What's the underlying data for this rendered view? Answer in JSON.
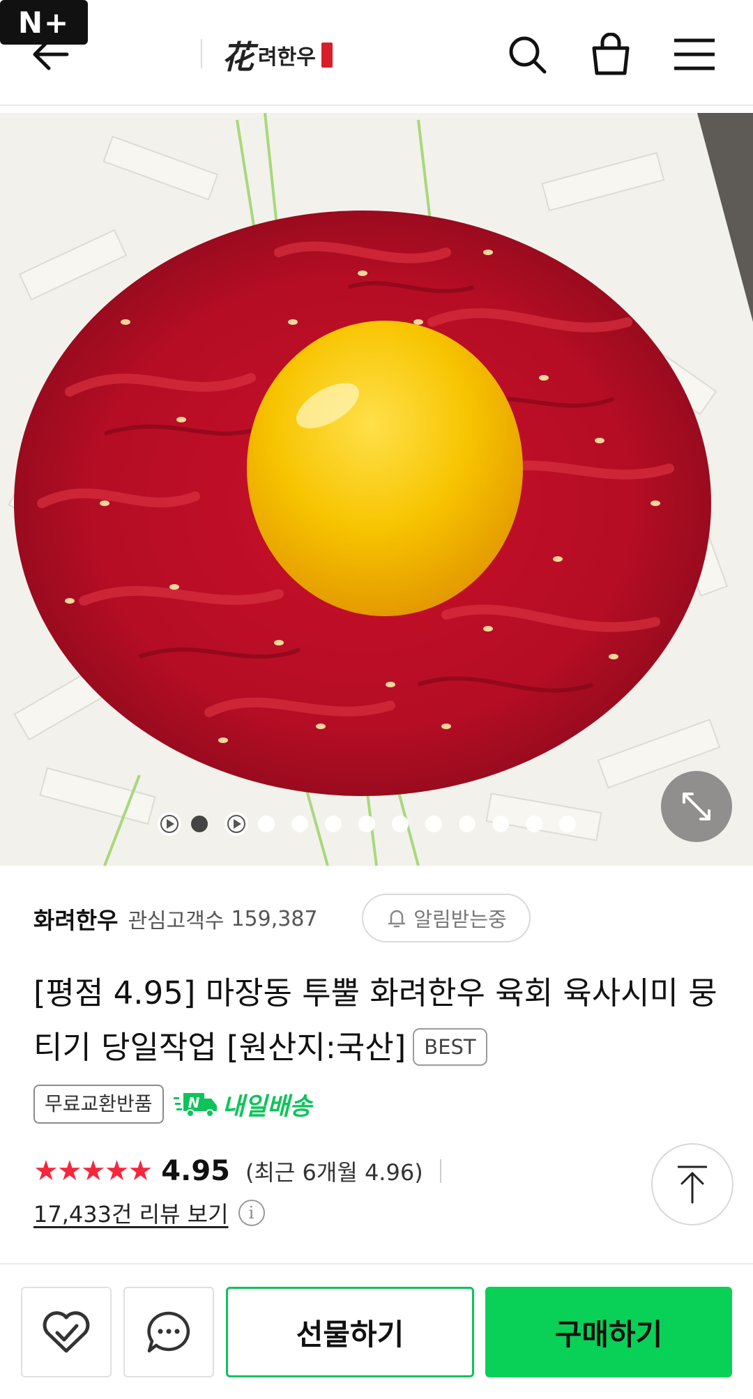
{
  "header": {
    "nplus_label": "N+",
    "brand_logo_hanja": "花",
    "brand_logo_text": "려한우",
    "back_icon": "arrow-left-icon",
    "search_icon": "search-icon",
    "cart_icon": "shopping-bag-icon",
    "menu_icon": "hamburger-menu-icon"
  },
  "gallery": {
    "total_slides": 13,
    "active_index": 1,
    "video_slides": [
      0,
      2
    ],
    "expand_icon": "expand-icon"
  },
  "store": {
    "name": "화려한우",
    "followers_label": "관심고객수",
    "followers_count": "159,387",
    "notify_label": "알림받는중",
    "notify_icon": "bell-icon"
  },
  "product": {
    "title": "[평점 4.95] 마장동 투뿔 화려한우 육회 육사시미 뭉티기 당일작업 [원산지:국산]",
    "best_badge": "BEST",
    "exchange_badge": "무료교환반품",
    "delivery_badge": "내일배송",
    "delivery_icon": "n-delivery-truck-icon"
  },
  "rating": {
    "stars": 5,
    "stars_text": "★★★★★",
    "score": "4.95",
    "recent_text": "(최근 6개월 4.96)",
    "review_link": "17,433건 리뷰 보기",
    "info_icon": "info-icon"
  },
  "bottom_bar": {
    "like_icon": "heart-check-icon",
    "talk_icon": "chat-bubble-icon",
    "gift_label": "선물하기",
    "buy_label": "구매하기"
  },
  "colors": {
    "accent_green": "#09d157",
    "star_red": "#f5273c",
    "delivery_green": "#0ec45a"
  }
}
